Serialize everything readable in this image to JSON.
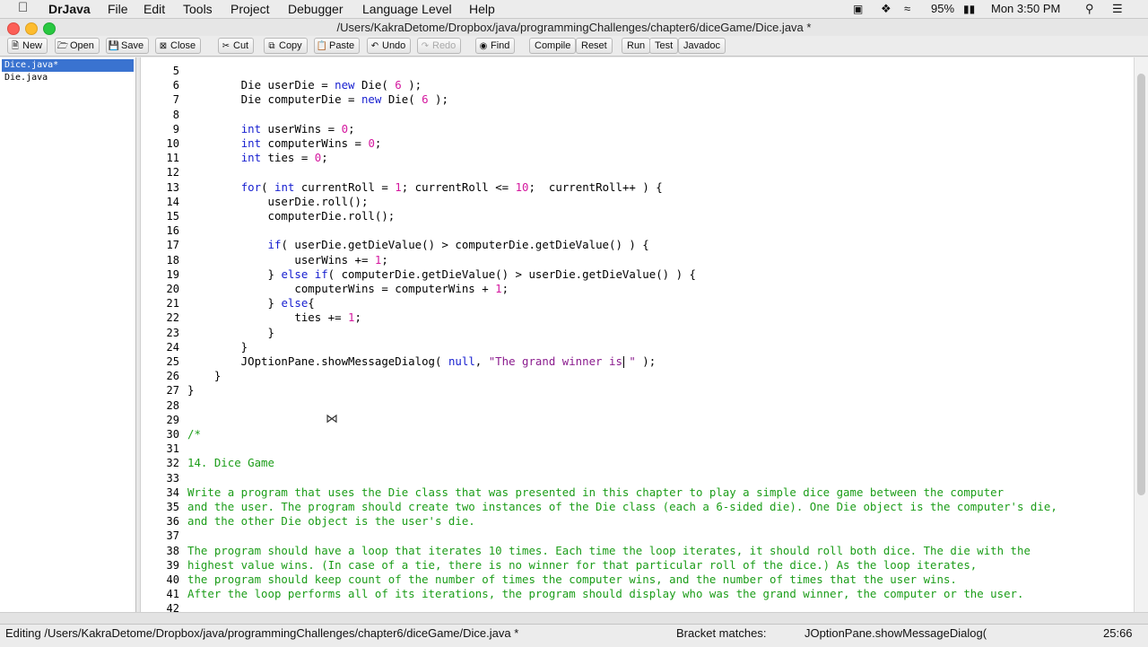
{
  "menubar": {
    "app_name": "DrJava",
    "items": [
      "File",
      "Edit",
      "Tools",
      "Project",
      "Debugger",
      "Language Level",
      "Help"
    ],
    "battery": "95%",
    "clock": "Mon 3:50 PM"
  },
  "window": {
    "title": "/Users/KakraDetome/Dropbox/java/programmingChallenges/chapter6/diceGame/Dice.java *"
  },
  "toolbar": {
    "new": "New",
    "open": "Open",
    "save": "Save",
    "close": "Close",
    "cut": "Cut",
    "copy": "Copy",
    "paste": "Paste",
    "undo": "Undo",
    "redo": "Redo",
    "find": "Find",
    "compile": "Compile",
    "reset": "Reset",
    "run": "Run",
    "test": "Test",
    "javadoc": "Javadoc"
  },
  "files": [
    "Dice.java*",
    "Die.java"
  ],
  "editor": {
    "lines": [
      {
        "n": "5",
        "code": ""
      },
      {
        "n": "6",
        "code": "        Die userDie = new Die( 6 );"
      },
      {
        "n": "7",
        "code": "        Die computerDie = new Die( 6 );"
      },
      {
        "n": "8",
        "code": ""
      },
      {
        "n": "9",
        "code": "        int userWins = 0;"
      },
      {
        "n": "10",
        "code": "        int computerWins = 0;"
      },
      {
        "n": "11",
        "code": "        int ties = 0;"
      },
      {
        "n": "12",
        "code": ""
      },
      {
        "n": "13",
        "code": "        for( int currentRoll = 1; currentRoll <= 10;  currentRoll++ ) {"
      },
      {
        "n": "14",
        "code": "            userDie.roll();"
      },
      {
        "n": "15",
        "code": "            computerDie.roll();"
      },
      {
        "n": "16",
        "code": ""
      },
      {
        "n": "17",
        "code": "            if( userDie.getDieValue() > computerDie.getDieValue() ) {"
      },
      {
        "n": "18",
        "code": "                userWins += 1;"
      },
      {
        "n": "19",
        "code": "            } else if( computerDie.getDieValue() > userDie.getDieValue() ) {"
      },
      {
        "n": "20",
        "code": "                computerWins = computerWins + 1;"
      },
      {
        "n": "21",
        "code": "            } else{"
      },
      {
        "n": "22",
        "code": "                ties += 1;"
      },
      {
        "n": "23",
        "code": "            }"
      },
      {
        "n": "24",
        "code": "        }"
      },
      {
        "n": "25",
        "code": "        JOptionPane.showMessageDialog( null, \"The grand winner is \" );"
      },
      {
        "n": "26",
        "code": "    }"
      },
      {
        "n": "27",
        "code": "}"
      },
      {
        "n": "28",
        "code": ""
      },
      {
        "n": "29",
        "code": ""
      },
      {
        "n": "30",
        "code": "/*"
      },
      {
        "n": "31",
        "code": ""
      },
      {
        "n": "32",
        "code": "14. Dice Game"
      },
      {
        "n": "33",
        "code": ""
      },
      {
        "n": "34",
        "code": "Write a program that uses the Die class that was presented in this chapter to play a simple dice game between the computer"
      },
      {
        "n": "35",
        "code": "and the user. The program should create two instances of the Die class (each a 6-sided die). One Die object is the computer's die,"
      },
      {
        "n": "36",
        "code": "and the other Die object is the user's die."
      },
      {
        "n": "37",
        "code": ""
      },
      {
        "n": "38",
        "code": "The program should have a loop that iterates 10 times. Each time the loop iterates, it should roll both dice. The die with the"
      },
      {
        "n": "39",
        "code": "highest value wins. (In case of a tie, there is no winner for that particular roll of the dice.) As the loop iterates,"
      },
      {
        "n": "40",
        "code": "the program should keep count of the number of times the computer wins, and the number of times that the user wins."
      },
      {
        "n": "41",
        "code": "After the loop performs all of its iterations, the program should display who was the grand winner, the computer or the user."
      },
      {
        "n": "42",
        "code": ""
      }
    ],
    "scroll_fraction": 0.12
  },
  "status": {
    "editing": "Editing /Users/KakraDetome/Dropbox/java/programmingChallenges/chapter6/diceGame/Dice.java *",
    "bracket_label": "Bracket matches:",
    "bracket_value": "JOptionPane.showMessageDialog(",
    "position": "25:66"
  },
  "colors": {
    "keyword": "#1820d0",
    "number": "#d4179e",
    "string": "#8b1c8e",
    "comment": "#1c9d19",
    "selection": "#3a73d0"
  }
}
